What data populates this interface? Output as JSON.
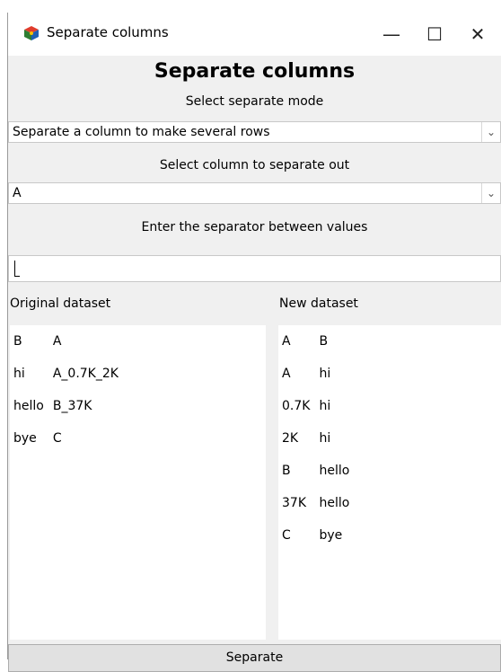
{
  "window": {
    "title": "Separate columns",
    "minimize_glyph": "—",
    "maximize_glyph": "☐",
    "close_glyph": "✕",
    "icon": "app-cube-icon"
  },
  "heading": "Separate columns",
  "mode": {
    "label": "Select separate mode",
    "value": "Separate a column to make several rows"
  },
  "column": {
    "label": "Select column to separate out",
    "value": "A"
  },
  "separator": {
    "label": "Enter the separator between values",
    "value": ""
  },
  "original": {
    "label": "Original dataset",
    "headers": [
      "B",
      "A"
    ],
    "rows": [
      [
        "hi",
        "A_0.7K_2K"
      ],
      [
        "hello",
        "B_37K"
      ],
      [
        "bye",
        "C"
      ]
    ]
  },
  "result": {
    "label": "New dataset",
    "headers": [
      "A",
      "B"
    ],
    "rows": [
      [
        "A",
        "hi"
      ],
      [
        "0.7K",
        "hi"
      ],
      [
        "2K",
        "hi"
      ],
      [
        "B",
        "hello"
      ],
      [
        "37K",
        "hello"
      ],
      [
        "C",
        "bye"
      ]
    ]
  },
  "separate_button": "Separate",
  "colors": {
    "window_bg": "#f0f0f0",
    "panel_bg": "#ffffff",
    "button_bg": "#e1e1e1"
  }
}
